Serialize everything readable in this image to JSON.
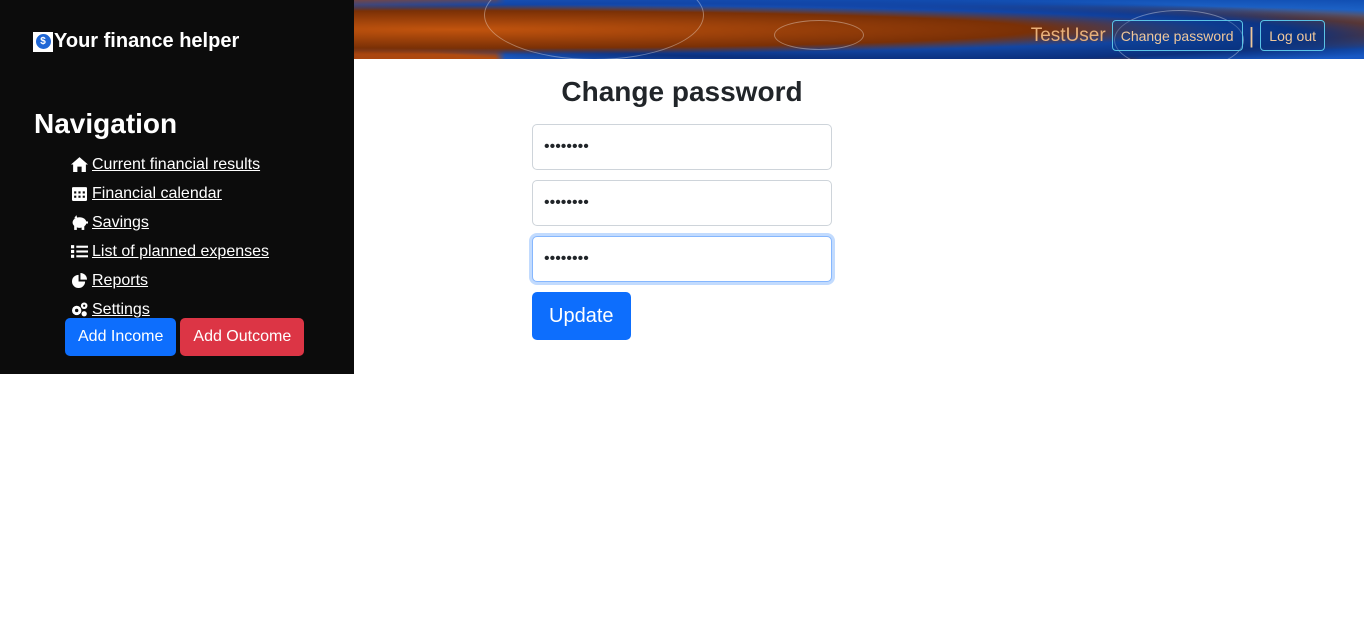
{
  "brand": {
    "title": "Your finance helper",
    "logo_glyph": "$"
  },
  "navigation": {
    "heading": "Navigation",
    "items": [
      {
        "label": "Current financial results",
        "icon": "home-icon"
      },
      {
        "label": "Financial calendar",
        "icon": "calendar-icon"
      },
      {
        "label": "Savings",
        "icon": "piggy-bank-icon"
      },
      {
        "label": "List of planned expenses",
        "icon": "list-icon"
      },
      {
        "label": "Reports",
        "icon": "pie-chart-icon"
      },
      {
        "label": "Settings",
        "icon": "gears-icon"
      }
    ]
  },
  "actions": {
    "add_income": "Add Income",
    "add_outcome": "Add Outcome"
  },
  "header": {
    "username": "TestUser",
    "change_password": "Change password",
    "separator": "|",
    "logout": "Log out"
  },
  "form": {
    "title": "Change password",
    "fields": [
      {
        "value": "••••••••"
      },
      {
        "value": "••••••••"
      },
      {
        "value": "••••••••"
      }
    ],
    "submit": "Update"
  },
  "colors": {
    "sidebar_bg": "#0c0c0c",
    "primary": "#0d6efd",
    "danger": "#dc3545",
    "header_text": "#f0c79a",
    "header_border": "#5ac3e6"
  }
}
